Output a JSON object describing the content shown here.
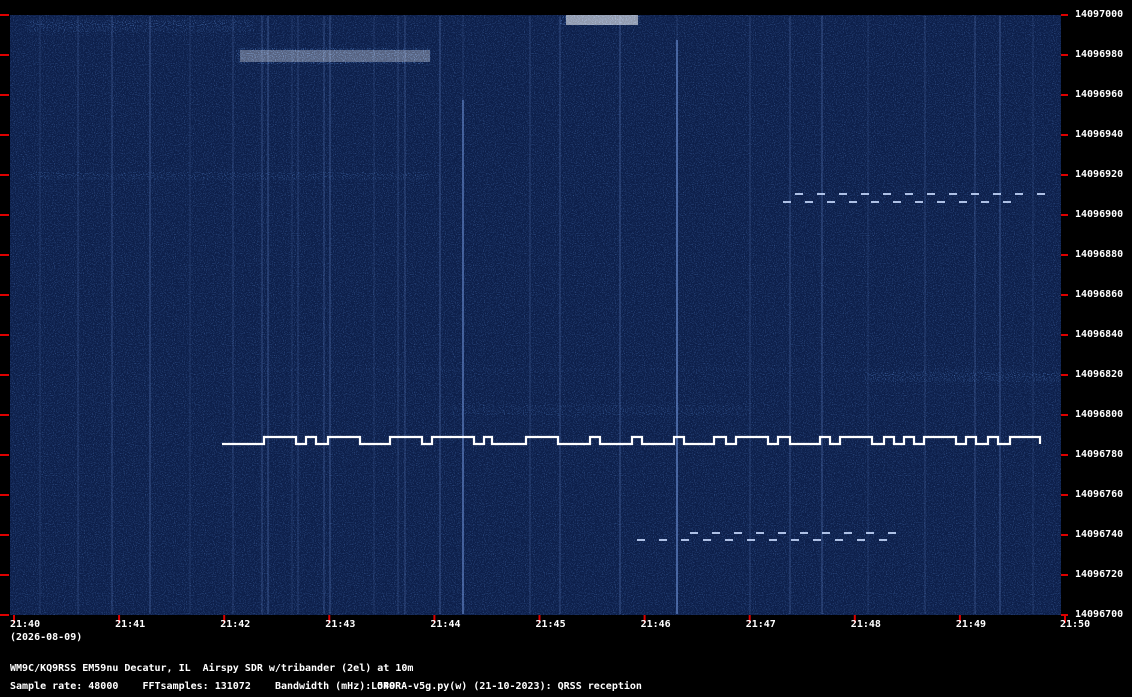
{
  "plot": {
    "freq_labels": [
      "14097000",
      "14096980",
      "14096960",
      "14096940",
      "14096920",
      "14096900",
      "14096880",
      "14096860",
      "14096840",
      "14096820",
      "14096800",
      "14096780",
      "14096760",
      "14096740",
      "14096720",
      "14096700"
    ],
    "time_labels": [
      "21:40",
      "21:41",
      "21:42",
      "21:43",
      "21:44",
      "21:45",
      "21:46",
      "21:47",
      "21:48",
      "21:49",
      "21:50"
    ],
    "date": "(2026-08-09)",
    "colors": {
      "background": "#0d1f4a",
      "signal": "#ffffff",
      "tick": "#dd0000"
    }
  },
  "footer": {
    "station": "WM9C/KQ9RSS EM59nu Decatur, IL  Airspy SDR w/tribander (2el) at 10m",
    "sample_rate": "Sample rate: 48000",
    "fft_samples": "FFTsamples: 131072",
    "bandwidth": "Bandwidth (mHz): 549",
    "program": "LOPORA-v5g.py(w) (21-10-2023): QRSS reception"
  }
}
